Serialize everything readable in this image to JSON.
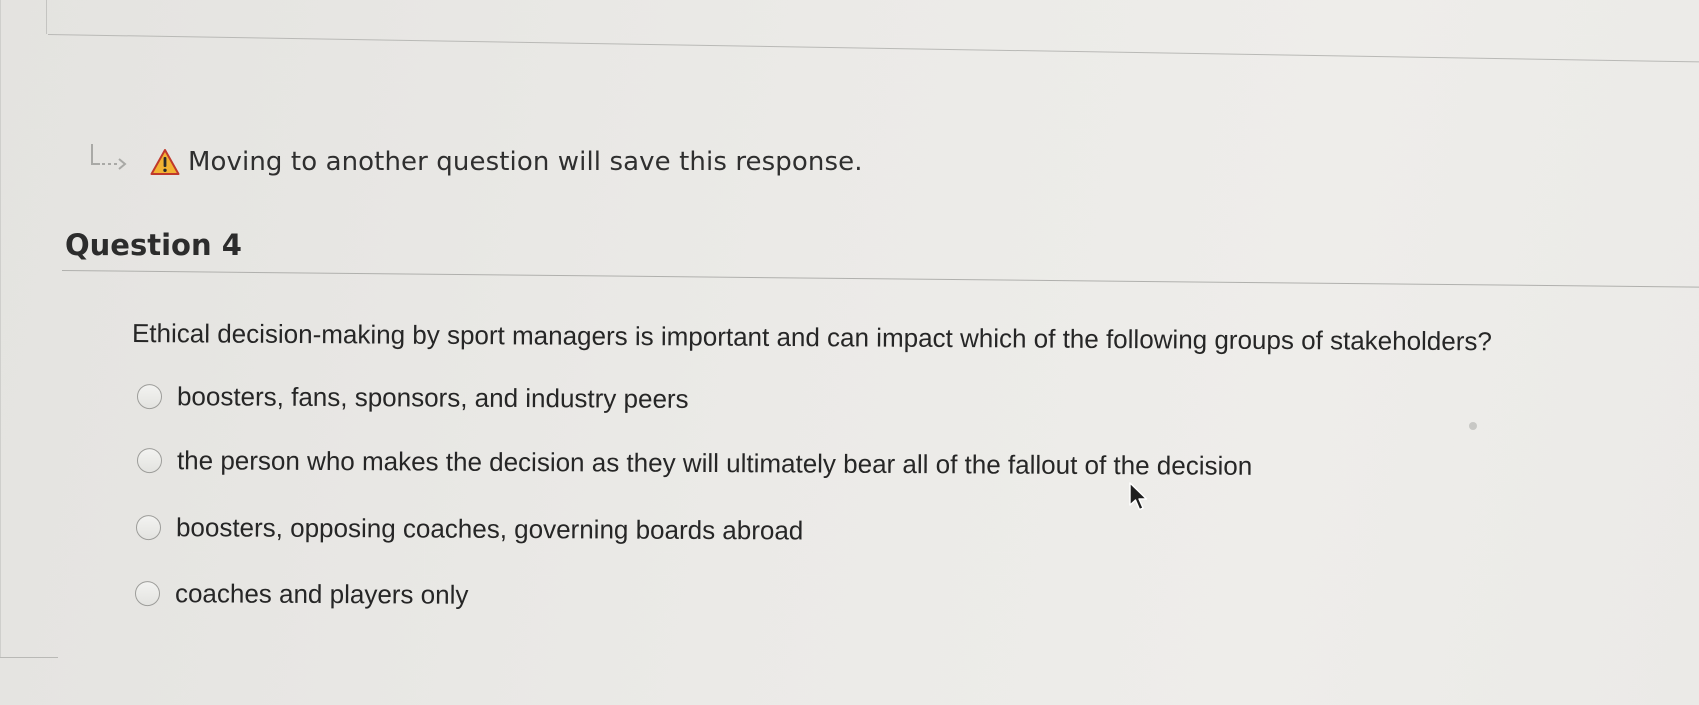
{
  "notice": {
    "arrow_icon": "return-arrow-icon",
    "warning_icon": "warning-icon",
    "text": "Moving to another question will save this response."
  },
  "question": {
    "title": "Question 4",
    "prompt": "Ethical decision-making by sport managers is important and can impact which of the following groups of stakeholders?",
    "answers": [
      "boosters, fans, sponsors, and industry peers",
      "the person who makes the decision as they will ultimately bear all of the fallout of the decision",
      "boosters, opposing coaches, governing boards abroad",
      "coaches and players only"
    ]
  },
  "colors": {
    "warning_fill": "#f2b233",
    "warning_stroke": "#c0392b",
    "background": "#ebeae7"
  }
}
